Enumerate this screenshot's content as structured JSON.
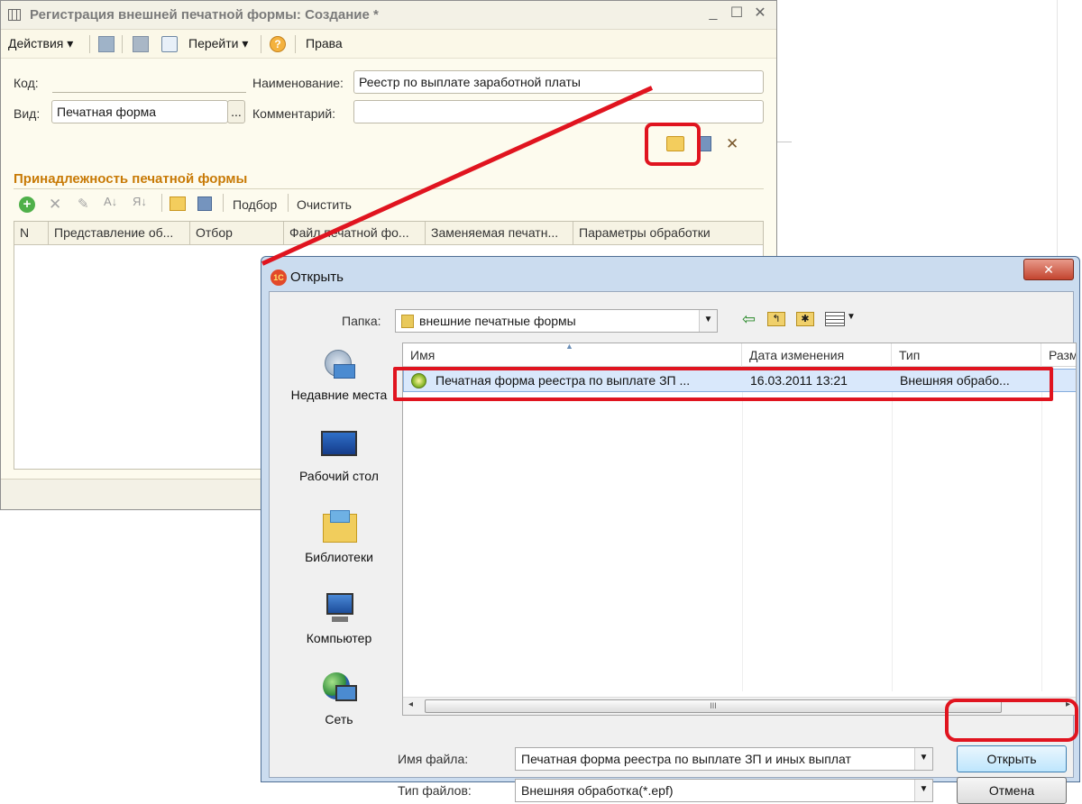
{
  "form": {
    "title": "Регистрация внешней печатной формы: Создание *",
    "toolbar": {
      "actions": "Действия",
      "goto": "Перейти",
      "help": "?",
      "rights": "Права"
    },
    "code_label": "Код:",
    "code_value": "",
    "name_label": "Наименование:",
    "name_value": "Реестр по выплате заработной платы",
    "kind_label": "Вид:",
    "kind_value": "Печатная форма",
    "kind_choose": "...",
    "comment_label": "Комментарий:",
    "comment_value": "",
    "section_title": "Принадлежность печатной формы",
    "grid_toolbar": {
      "pick": "Подбор",
      "clear": "Очистить"
    },
    "grid_columns": [
      "N",
      "Представление об...",
      "Отбор",
      "Файл печатной фо...",
      "Заменяемая печатн...",
      "Параметры обработки"
    ]
  },
  "dialog": {
    "title": "Открыть",
    "logo_text": "1С",
    "folder_label": "Папка:",
    "folder_value": "внешние печатные формы",
    "places": [
      {
        "label": "Недавние места"
      },
      {
        "label": "Рабочий стол"
      },
      {
        "label": "Библиотеки"
      },
      {
        "label": "Компьютер"
      },
      {
        "label": "Сеть"
      }
    ],
    "columns": [
      "Имя",
      "Дата изменения",
      "Тип",
      "Разм"
    ],
    "file": {
      "name": "Печатная форма реестра по выплате ЗП ...",
      "date": "16.03.2011 13:21",
      "type": "Внешняя обрабо..."
    },
    "scroll_grip": "III",
    "filename_label": "Имя файла:",
    "filename_value": "Печатная форма реестра по выплате ЗП и иных выплат",
    "filetype_label": "Тип файлов:",
    "filetype_value": "Внешняя обработка(*.epf)",
    "open_button": "Открыть",
    "cancel_button": "Отмена"
  },
  "colors": {
    "highlight": "#e0141f",
    "section_title": "#c87a06"
  }
}
